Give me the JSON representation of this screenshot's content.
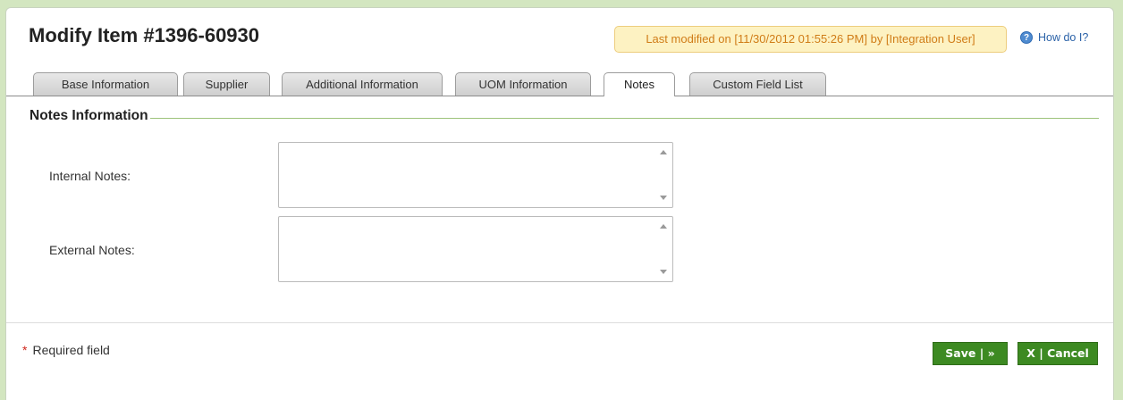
{
  "header": {
    "title": "Modify Item #1396-60930",
    "last_modified": "Last modified on [11/30/2012 01:55:26 PM] by [Integration User]",
    "help_label": "How do I?",
    "help_icon": "question-circle-icon"
  },
  "tabs": [
    {
      "label": "Base Information"
    },
    {
      "label": "Supplier"
    },
    {
      "label": "Additional Information"
    },
    {
      "label": "UOM Information"
    },
    {
      "label": "Notes",
      "active": true
    },
    {
      "label": "Custom Field List"
    }
  ],
  "section": {
    "title": "Notes Information"
  },
  "fields": {
    "internal_notes": {
      "label": "Internal Notes",
      "separator": ":",
      "value": ""
    },
    "external_notes": {
      "label": "External Notes",
      "separator": ":",
      "value": ""
    }
  },
  "footer": {
    "required_star": "*",
    "required_text": "Required field",
    "save_label": "Save | »",
    "cancel_label": "X | Cancel"
  },
  "colors": {
    "accent_green": "#3d8a22",
    "page_background": "#d3e6c0",
    "notice_background": "#fdf2c2",
    "notice_text": "#d07c17",
    "required_star": "#d0271c"
  }
}
